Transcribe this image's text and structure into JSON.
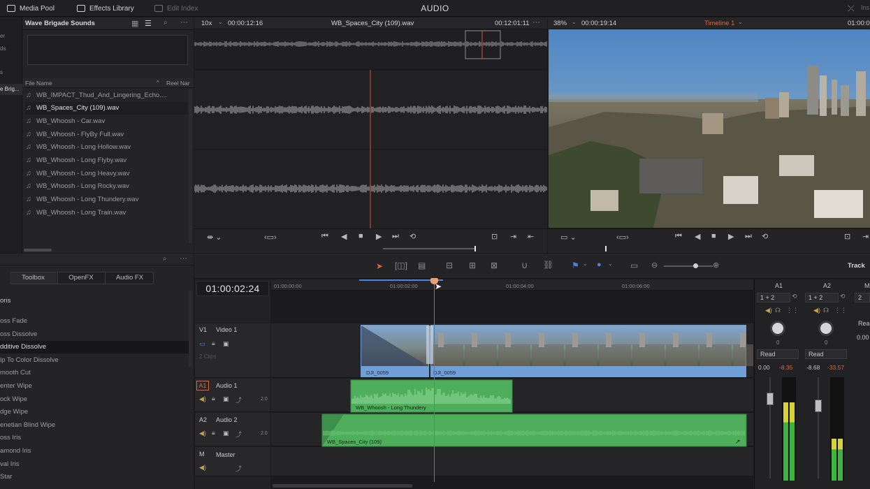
{
  "topbar": {
    "media_pool": "Media Pool",
    "effects_library": "Effects Library",
    "edit_index": "Edit Index",
    "page_title": "AUDIO"
  },
  "media_pool": {
    "bin_name": "Wave Brigade Sounds",
    "col_file_name": "File Name",
    "col_reel_name": "Reel Nar",
    "side_labels": [
      "er",
      "ds",
      "s",
      "e Brig..."
    ],
    "files": [
      "WB_IMPACT_Thud_And_Lingering_Echo....",
      "WB_Spaces_City (109).wav",
      "WB_Whoosh - Car.wav",
      "WB_Whoosh - FlyBy Full.wav",
      "WB_Whoosh - Long  Hollow.wav",
      "WB_Whoosh - Long Flyby.wav",
      "WB_Whoosh - Long Heavy.wav",
      "WB_Whoosh - Long Rocky.wav",
      "WB_Whoosh - Long Thundery.wav",
      "WB_Whoosh - Long Train.wav"
    ],
    "selected_index": 1
  },
  "effects": {
    "tabs": [
      "Toolbox",
      "OpenFX",
      "Audio FX"
    ],
    "active_tab": "Toolbox",
    "section_title": "ons",
    "items": [
      "oss Fade",
      "oss Dissolve",
      "dditive Dissolve",
      "ip To Color Dissolve",
      "mooth Cut",
      "enter Wipe",
      "ock Wipe",
      "dge Wipe",
      "enetian Blind Wipe",
      "oss Iris",
      "amond Iris",
      "val Iris",
      "Star"
    ],
    "selected_index": 2
  },
  "source_viewer": {
    "zoom": "10x",
    "timecode": "00:00:12:16",
    "clip_name": "WB_Spaces_City (109).wav",
    "duration": "00:12:01:11"
  },
  "timeline_viewer": {
    "zoom": "38%",
    "timecode": "00:00:19:14",
    "timeline_name": "Timeline 1",
    "timecode_right": "01:00:0"
  },
  "timeline": {
    "current_timecode": "01:00:02:24",
    "ruler_ticks": [
      "01:00:00:00",
      "01:00:02:00",
      "01:00:04:00",
      "01:00:06:00"
    ],
    "toolbar_right_label": "Track",
    "tracks": [
      {
        "id": "V1",
        "name": "Video 1",
        "sub": "2 Clips"
      },
      {
        "id": "A1",
        "name": "Audio 1",
        "level": "2.0"
      },
      {
        "id": "A2",
        "name": "Audio 2",
        "level": "2.0"
      },
      {
        "id": "M",
        "name": "Master"
      }
    ],
    "clips": {
      "video_a": "DJI_0059",
      "video_b": "DJI_0059",
      "audio1": "WB_Whoosh - Long Thundery",
      "audio2": "WB_Spaces_City (109)"
    }
  },
  "mixer": {
    "channels": [
      {
        "name": "A1",
        "route": "1 + 2",
        "pan": "0",
        "mode": "Read",
        "fader": "0.00",
        "peak": "-8.35"
      },
      {
        "name": "A2",
        "route": "1 + 2",
        "pan": "0",
        "mode": "Read",
        "fader": "-8.68",
        "peak": "-33.57"
      }
    ],
    "extra_route": "2",
    "extra_mode": "Rea",
    "extra_fader": "0.00",
    "extra_label": "M"
  },
  "colors": {
    "accent": "#e0653c",
    "video_clip": "#6f9fd6",
    "audio_clip": "#4fae5b",
    "playhead": "#d8523a"
  }
}
